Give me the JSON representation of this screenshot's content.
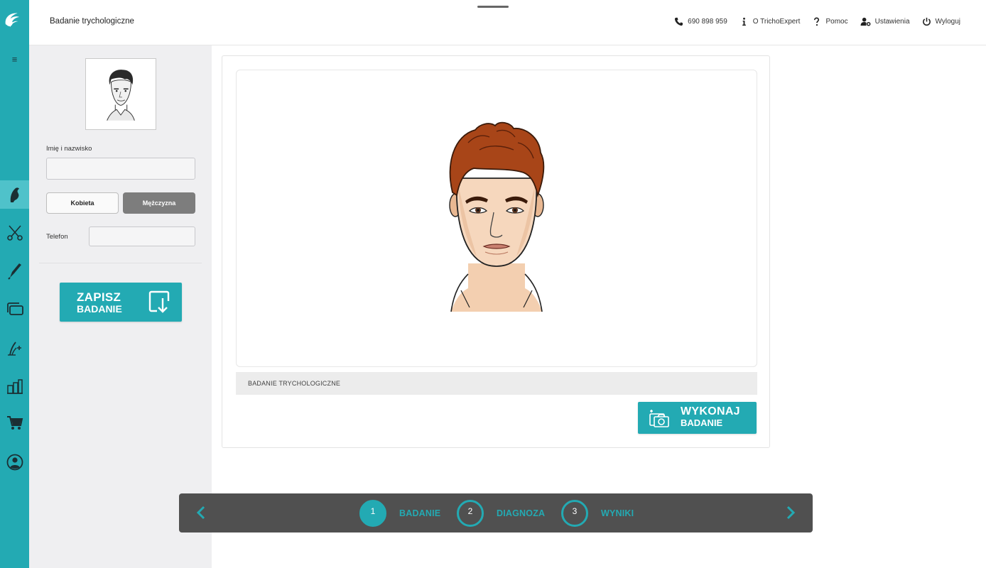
{
  "header": {
    "title": "Badanie trychologiczne",
    "phone": "690 898 959",
    "about": "O TrichoExpert",
    "help": "Pomoc",
    "settings": "Ustawienia",
    "logout": "Wyloguj"
  },
  "sidebar": {
    "menu_icon": "≡",
    "items": [
      {
        "icon": "hair-profile-icon",
        "active": true
      },
      {
        "icon": "scissors-icon",
        "active": false
      },
      {
        "icon": "razor-icon",
        "active": false
      },
      {
        "icon": "gallery-icon",
        "active": false
      },
      {
        "icon": "hair-add-icon",
        "active": false
      },
      {
        "icon": "products-icon",
        "active": false
      },
      {
        "icon": "cart-icon",
        "active": false
      },
      {
        "icon": "user-icon",
        "active": false
      }
    ]
  },
  "panel": {
    "name_label": "Imię i nazwisko",
    "name_value": "",
    "female_label": "Kobieta",
    "male_label": "Mężczyzna",
    "selected_gender": "Mężczyzna",
    "phone_label": "Telefon",
    "phone_value": "",
    "save_line1": "ZAPISZ",
    "save_line2": "BADANIE"
  },
  "main": {
    "caption": "BADANIE TRYCHOLOGICZNE",
    "action_line1": "WYKONAJ",
    "action_line2": "BADANIE"
  },
  "stepper": {
    "steps": [
      {
        "number": "1",
        "label": "BADANIE",
        "active": true
      },
      {
        "number": "2",
        "label": "DIAGNOZA",
        "active": false
      },
      {
        "number": "3",
        "label": "WYNIKI",
        "active": false
      }
    ]
  },
  "colors": {
    "accent": "#23aab3",
    "panel_bg": "#efeff1",
    "stepper_bg": "#505050"
  }
}
